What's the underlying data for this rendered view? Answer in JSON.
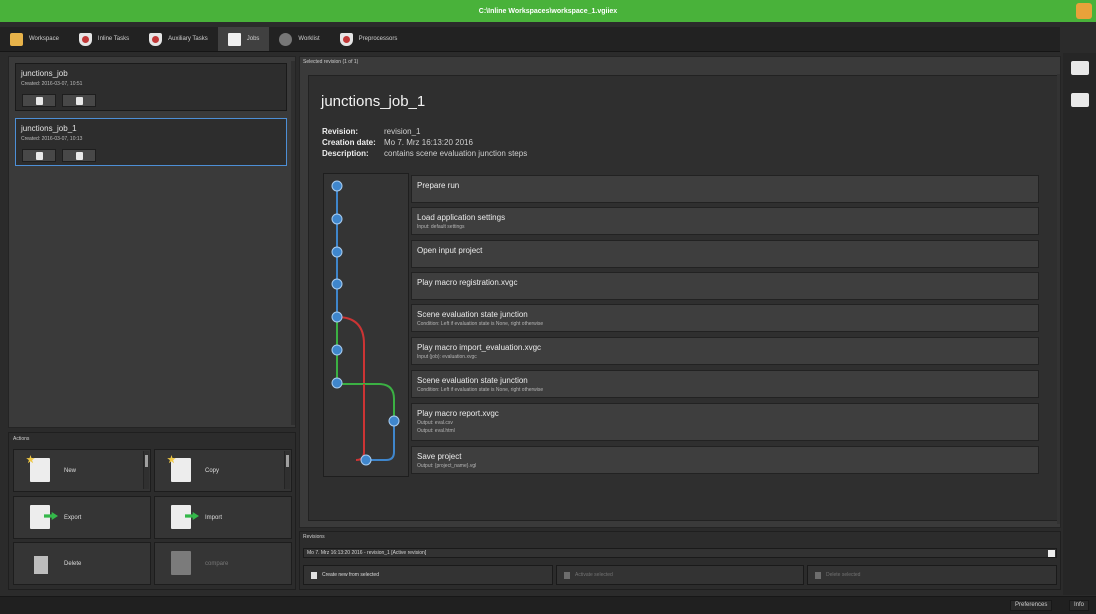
{
  "window": {
    "title": "C:\\Inline Workspaces\\workspace_1.vgiiex"
  },
  "tabs": [
    {
      "label": "Workspace",
      "icon": "folder-icon",
      "active": false
    },
    {
      "label": "Inline Tasks",
      "icon": "shield-icon",
      "active": false
    },
    {
      "label": "Auxiliary Tasks",
      "icon": "shield-icon",
      "active": false
    },
    {
      "label": "Jobs",
      "icon": "document-icon",
      "active": true
    },
    {
      "label": "Worklist",
      "icon": "gear-icon",
      "active": false
    },
    {
      "label": "Preprocessors",
      "icon": "shield-icon",
      "active": false
    }
  ],
  "jobs": [
    {
      "title": "junctions_job",
      "created": "Created: 2016-03-07, 10:51",
      "selected": false
    },
    {
      "title": "junctions_job_1",
      "created": "Created: 2016-03-07, 10:13",
      "selected": true
    }
  ],
  "actions": {
    "label": "Actions",
    "new": "New",
    "copy": "Copy",
    "export": "Export",
    "import": "Import",
    "delete": "Delete",
    "compare": "compare"
  },
  "selected_revision": {
    "panel_label": "Selected revision (1 of 1)",
    "job_name": "junctions_job_1",
    "revision_label": "Revision:",
    "revision_value": "revision_1",
    "creation_label": "Creation date:",
    "creation_value": "Mo 7. Mrz 16:13:20 2016",
    "description_label": "Description:",
    "description_value": "contains scene evaluation junction steps"
  },
  "steps": [
    {
      "name": "Prepare run",
      "sub": []
    },
    {
      "name": "Load application settings",
      "sub": [
        "Input: default settings"
      ]
    },
    {
      "name": "Open input project",
      "sub": []
    },
    {
      "name": "Play macro registration.xvgc",
      "sub": []
    },
    {
      "name": "Scene evaluation state junction",
      "sub": [
        "Condition: Left if evaluation state is None, right otherwise"
      ]
    },
    {
      "name": "Play macro import_evaluation.xvgc",
      "sub": [
        "Input (job): evaluation.xvgc"
      ]
    },
    {
      "name": "Scene evaluation state junction",
      "sub": [
        "Condition: Left if evaluation state is None, right otherwise"
      ]
    },
    {
      "name": "Play macro report.xvgc",
      "sub": [
        "Output: eval.csv",
        "Output: eval.html"
      ]
    },
    {
      "name": "Save project",
      "sub": [
        "Output: {project_name}.vgl"
      ]
    }
  ],
  "revisions": {
    "label": "Revisions",
    "current": "Mo 7. Mrz 16:13:20 2016 - revision_1 [Active revision]",
    "create_new": "Create new from selected",
    "activate": "Activate selected",
    "delete": "Delete selected"
  },
  "statusbar": {
    "preferences": "Preferences",
    "info": "Info"
  },
  "colors": {
    "titlebar": "#49b23a",
    "selection": "#4d8fd6",
    "node": "#3f86cc",
    "branch_left": "#cc3434",
    "branch_right": "#3bb043"
  }
}
